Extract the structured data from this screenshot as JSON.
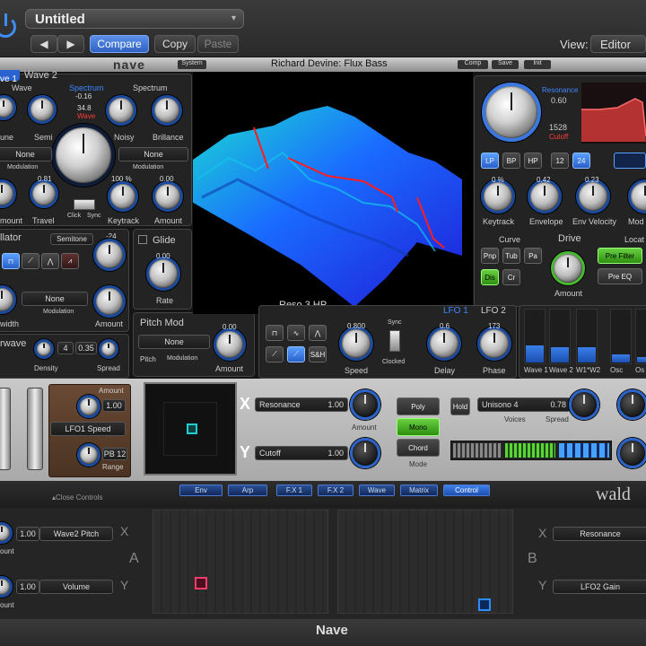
{
  "host": {
    "title": "Untitled",
    "compare": "Compare",
    "copy": "Copy",
    "paste": "Paste",
    "view_label": "View:",
    "view_value": "Editor",
    "bottom_title": "Nave"
  },
  "plugin": {
    "logo": "nave",
    "system": "System",
    "preset": "Richard Devine: Flux Bass",
    "top_buttons": [
      "Comp",
      "Save",
      "Init"
    ]
  },
  "wave_panel": {
    "tab1": "ve 1",
    "tab2": "Wave 2",
    "wave": "Wave",
    "spectrum1": "Spectrum",
    "spectrum2": "Spectrum",
    "v_neg016": "-0.16",
    "v_348": "34.8",
    "wave_red": "Wave",
    "tune": "une",
    "semi": "Semi",
    "noisy": "Noisy",
    "brillance": "Brillance",
    "none1": "None",
    "none2": "None",
    "modulation1": "Modulation",
    "modulation2": "Modulation",
    "amount": "mount",
    "travel": "Travel",
    "v_081": "0.81",
    "click": "Click",
    "sync": "Sync",
    "v_100p": "100 %",
    "keytrack": "Keytrack",
    "v_000": "0.00",
    "amount2": "Amount"
  },
  "osc_panel": {
    "title": "llator",
    "semitone": "Semitone",
    "v_24": "-24",
    "none": "None",
    "modulation": "Modulation",
    "width": "width",
    "amount": "Amount"
  },
  "glide": {
    "title": "Glide",
    "rate": "Rate",
    "v_000": "0.00"
  },
  "pitchmod": {
    "title": "Pitch Mod",
    "none": "None",
    "pitch": "Pitch",
    "modulation": "Modulation",
    "v_000": "0.00",
    "amount": "Amount"
  },
  "underwave": {
    "title": "rwave",
    "v_4": "4",
    "v_035": "0.35",
    "density": "Density",
    "spread": "Spread"
  },
  "filter": {
    "resonance": "Resonance",
    "v_060": "0.60",
    "v_1528": "1528",
    "cutoff": "Cutoff",
    "lp": "LP",
    "bp": "BP",
    "hp": "HP",
    "n12": "12",
    "n24": "24",
    "v_0p": "0 %",
    "v_042": "0.42",
    "v_023": "0.23",
    "keytrack": "Keytrack",
    "envelope": "Envelope",
    "envvel": "Env Velocity",
    "modc": "Mod c",
    "curve": "Curve",
    "drive": "Drive",
    "locat": "Locat",
    "pnp": "Pnp",
    "tub": "Tub",
    "pa": "Pa",
    "dis": "Dis",
    "cr": "Cr",
    "prefilter": "Pre Filter",
    "preeq": "Pre EQ",
    "amount": "Amount"
  },
  "display": {
    "reso": "Reso 3 HP"
  },
  "lfo": {
    "lfo1": "LFO 1",
    "lfo2": "LFO 2",
    "sync": "Sync",
    "clocked": "Clocked",
    "v_0800": "0.800",
    "v_06": "0.6",
    "v_173": "173",
    "speed": "Speed",
    "delay": "Delay",
    "phase": "Phase",
    "sh": "S&H"
  },
  "wavemix": {
    "labels": [
      "Wave 1",
      "Wave 2",
      "W1*W2",
      "Osc",
      "Os"
    ],
    "levels": [
      0.32,
      0.28,
      0.28,
      0.15,
      0.1
    ]
  },
  "mid": {
    "amount": "Amount",
    "v_100": "1.00",
    "lfo1speed": "LFO1 Speed",
    "pb12": "PB 12",
    "range": "Range",
    "x": "X",
    "y": "Y",
    "resonance": "Resonance",
    "cutoff": "Cutoff",
    "v_100b": "1.00",
    "v_100c": "1.00",
    "amount_x": "Amount",
    "poly": "Poly",
    "mono": "Mono",
    "chord": "Chord",
    "mode": "Mode",
    "hold": "Hold",
    "unisono": "Unisono 4",
    "v_078": "0.78",
    "voices": "Voices",
    "spread": "Spread"
  },
  "tabs": {
    "close": "▴Close Controls",
    "items": [
      "Env",
      "Arp",
      "F.X 1",
      "F.X 2",
      "Wave",
      "Matrix",
      "Control"
    ],
    "brand": "wald"
  },
  "bottom": {
    "v_100a": "1.00",
    "wave2pitch": "Wave2 Pitch",
    "mount_a": "ount",
    "x": "X",
    "a": "A",
    "y": "Y",
    "v_100b": "1.00",
    "volume": "Volume",
    "mount_b": "ount",
    "b": "B",
    "x2": "X",
    "y2": "Y",
    "resonance": "Resonance",
    "lfo2gain": "LFO2 Gain"
  },
  "colors": {
    "accent": "#2a6ae0",
    "active_green": "#4fc42a",
    "bg": "#1a1a1a"
  }
}
